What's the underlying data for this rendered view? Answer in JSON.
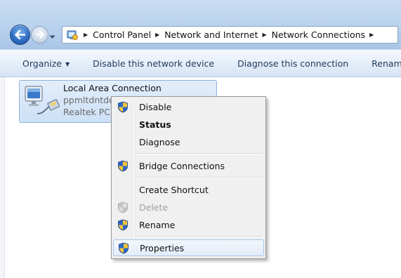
{
  "address": {
    "crumbs": [
      "Control Panel",
      "Network and Internet",
      "Network Connections"
    ]
  },
  "toolbar": {
    "organize": "Organize",
    "disable": "Disable this network device",
    "diagnose": "Diagnose this connection",
    "rename": "Rename t"
  },
  "connection": {
    "name": "Local Area Connection",
    "status": "ppmltdntdo",
    "device": "Realtek PCI"
  },
  "context_menu": {
    "items": [
      {
        "label": "Disable"
      },
      {
        "label": "Status"
      },
      {
        "label": "Diagnose"
      },
      {
        "label": "Bridge Connections"
      },
      {
        "label": "Create Shortcut"
      },
      {
        "label": "Delete"
      },
      {
        "label": "Rename"
      },
      {
        "label": "Properties"
      }
    ]
  }
}
